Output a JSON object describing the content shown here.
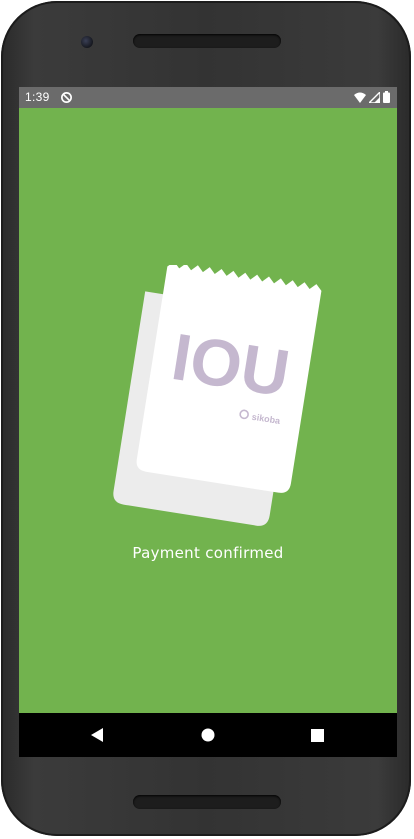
{
  "status_bar": {
    "time": "1:39",
    "icons": [
      "sync-icon",
      "wifi-icon",
      "signal-icon",
      "battery-icon"
    ]
  },
  "receipt": {
    "logo_text": "IOU",
    "brand": "sikoba"
  },
  "message": "Payment confirmed",
  "navigation": {
    "buttons": [
      "back-icon",
      "home-icon",
      "recents-icon"
    ]
  },
  "colors": {
    "background": "#72b34e",
    "status_bar": "#6b6b6b",
    "nav_bar": "#000000",
    "logo": "#c5b8cf",
    "receipt_front": "#ffffff",
    "receipt_back": "#ececec"
  }
}
